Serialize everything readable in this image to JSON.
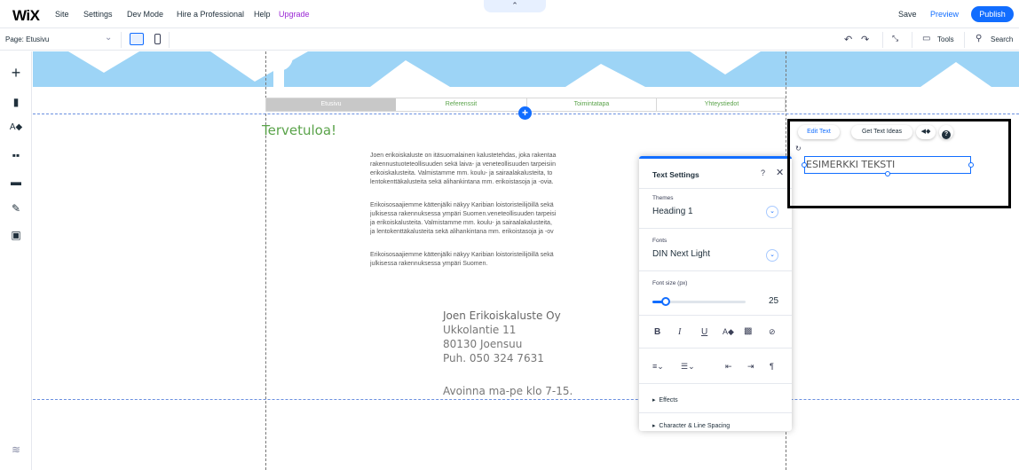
{
  "topbar": {
    "logo": "WiX",
    "menu": [
      "Site",
      "Settings",
      "Dev Mode",
      "Hire a Professional",
      "Help",
      "Upgrade"
    ],
    "collapse_glyph": "⌃",
    "save": "Save",
    "preview": "Preview",
    "publish": "Publish"
  },
  "secondbar": {
    "page": "Page: Etusivu",
    "tools": "Tools",
    "search": "Search"
  },
  "site": {
    "nav": [
      "Etusivu",
      "Referenssit",
      "Toimintatapa",
      "Yhteystiedot"
    ],
    "welcome": "Tervetuloa!",
    "para1": [
      "Joen erikoiskaluste on itäsuomalainen kalustetehdas, joka rakentaa",
      "rakennustuoteteollisuuden sekä laiva- ja veneteollisuuden tarpeisiin",
      "erikoiskalusteita. Valmistamme mm. koulu- ja sairaalakalusteita, to",
      "lentokenttäkalusteita sekä alihankintana mm. erikoistasoja ja -ovia."
    ],
    "para2": [
      "Erikoisosaajiemme kättenjälki näkyy Karibian loistoristeilijöillä sekä",
      "julkisessa rakennuksessa ympäri Suomen.veneteollisuuden tarpeisi",
      "ja erikoiskalusteita. Valmistamme mm. koulu- ja sairaalakalusteita,",
      "ja lentokenttäkalusteita sekä alihankintana mm. erikoistasoja ja -ov"
    ],
    "para3": [
      "Erikoisosaajiemme kättenjälki näkyy Karibian loistoristeilijöillä sekä",
      "julkisessa rakennuksessa ympäri Suomen."
    ],
    "company": [
      "Joen Erikoiskaluste Oy",
      "Ukkolantie 11",
      "80130 Joensuu",
      "Puh. 050 324 7631"
    ],
    "hours": "Avoinna ma-pe klo 7-15."
  },
  "text_settings": {
    "title": "Text Settings",
    "help": "?",
    "close": "✕",
    "themes_label": "Themes",
    "themes_value": "Heading 1",
    "fonts_label": "Fonts",
    "fonts_value": "DIN Next Light",
    "font_size_label": "Font size (px)",
    "font_size_value": "25",
    "font_size_slider_fraction": 0.14,
    "effects": "Effects",
    "spacing": "Character & Line Spacing"
  },
  "element_toolbar": {
    "edit_text": "Edit Text",
    "get_ideas": "Get Text Ideas",
    "help": "?"
  },
  "selected_text": "ESIMERKKI TEKSTI",
  "colors": {
    "accent": "#116dff",
    "upgrade": "#9a27d5",
    "site_green": "#5aa34a",
    "banner": "#9dd4f6"
  }
}
